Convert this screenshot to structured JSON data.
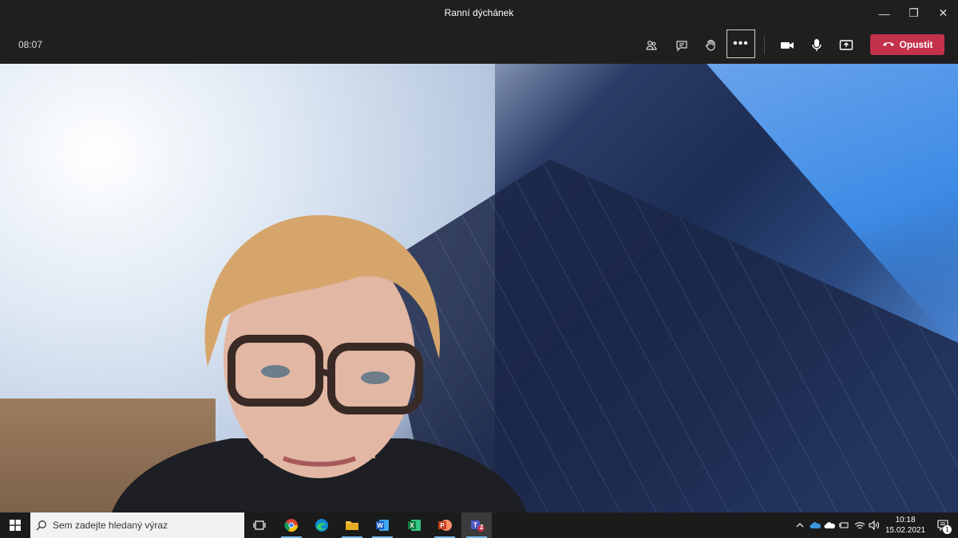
{
  "window": {
    "title": "Ranní dýchánek",
    "minimize_glyph": "—",
    "restore_glyph": "❐",
    "close_glyph": "✕"
  },
  "toolbar": {
    "timer": "08:07",
    "more_glyph": "•••",
    "leave_label": "Opustit",
    "icons": [
      "participants-icon",
      "chat-icon",
      "raise-hand-icon",
      "more-options-icon",
      "camera-icon",
      "microphone-icon",
      "share-screen-icon",
      "hang-up-icon"
    ]
  },
  "taskbar": {
    "search_placeholder": "Sem zadejte hledaný výraz",
    "apps": [
      "task-view-icon",
      "chrome-icon",
      "edge-icon",
      "file-explorer-icon",
      "word-icon",
      "excel-icon",
      "powerpoint-icon",
      "teams-icon"
    ],
    "teams_badge": "2",
    "clock_time": "10:18",
    "clock_date": "15.02.2021",
    "notification_count": "1"
  },
  "colors": {
    "leave_red": "#c4314b",
    "toolbar_bg": "#1f1f1f",
    "taskbar_bg": "#1b1b1b"
  }
}
